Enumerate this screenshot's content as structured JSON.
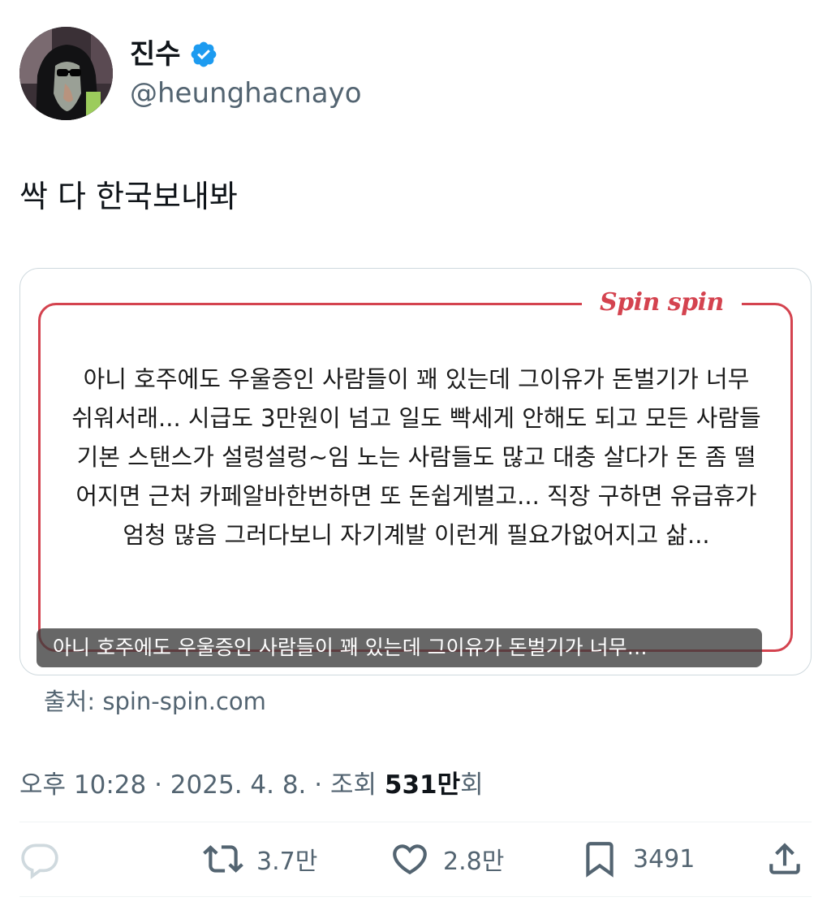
{
  "author": {
    "display_name": "진수",
    "handle": "@heunghacnayo",
    "verified": true,
    "avatar_icon": "avatar-hooded-figure-sunglasses"
  },
  "tweet": {
    "text": "싹 다 한국보내봐"
  },
  "card": {
    "brand": "Spin spin",
    "body": "아니 호주에도 우울증인 사람들이 꽤 있는데 그이유가 돈벌기가 너무 쉬워서래... 시급도 3만원이 넘고 일도 빡세게 안해도 되고 모든 사람들 기본 스탠스가 설렁설렁~임 노는 사람들도 많고 대충 살다가 돈 좀 떨어지면 근처 카페알바한번하면 또 돈쉽게벌고... 직장 구하면 유급휴가 엄청 많음 그러다보니 자기계발 이런게 필요가없어지고 삶...",
    "caption": "아니 호주에도 우울증인 사람들이 꽤 있는데 그이유가 돈벌기가 너무…",
    "source": "출처: spin-spin.com",
    "accent_color": "#d4434f"
  },
  "meta": {
    "time": "오후 10:28",
    "sep1": " · ",
    "date": "2025. 4. 8.",
    "sep2": " · ",
    "views_label": "조회 ",
    "views_count": "531만",
    "views_suffix": "회"
  },
  "actions": {
    "reply": {
      "icon": "reply-icon",
      "count": ""
    },
    "retweet": {
      "icon": "retweet-icon",
      "count": "3.7만"
    },
    "like": {
      "icon": "heart-icon",
      "count": "2.8만"
    },
    "bookmark": {
      "icon": "bookmark-icon",
      "count": "3491"
    },
    "share": {
      "icon": "share-icon"
    }
  },
  "colors": {
    "text_primary": "#0f1419",
    "text_secondary": "#536471",
    "verified_blue": "#1d9bf0",
    "border": "#cfd9de"
  }
}
